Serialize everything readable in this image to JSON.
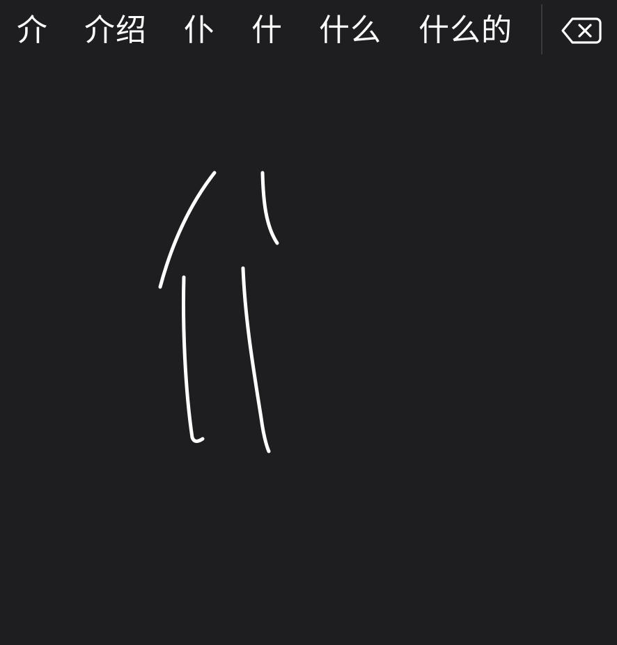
{
  "candidates": [
    {
      "text": "介"
    },
    {
      "text": "介绍"
    },
    {
      "text": "仆"
    },
    {
      "text": "什"
    },
    {
      "text": "什么"
    },
    {
      "text": "什么的"
    }
  ],
  "delete_button": {
    "icon": "delete-backspace-icon"
  },
  "colors": {
    "background": "#1e1d20",
    "text": "#ffffff",
    "ink": "#ffffff",
    "divider": "#3a393d"
  }
}
